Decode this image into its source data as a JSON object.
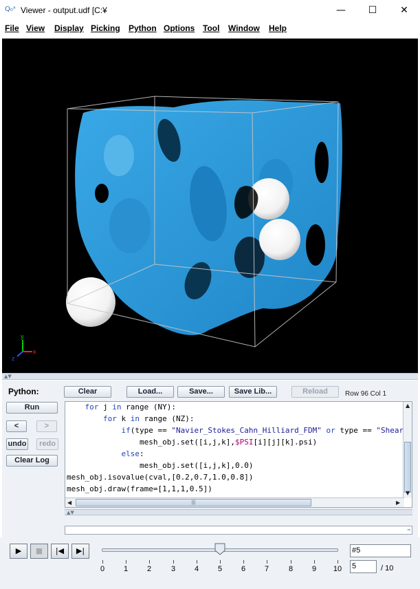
{
  "window": {
    "icon_text": "Q₀ᵃ",
    "title": "Viewer - output.udf [C:¥",
    "minimize_glyph": "—",
    "maximize_glyph": "☐",
    "close_glyph": "✕"
  },
  "menu": [
    "File",
    "Display",
    "Picking",
    "Python",
    "Options",
    "Tool",
    "Window",
    "Help"
  ],
  "menu_view": "View",
  "viewport": {
    "background": "#000000",
    "surface_color": "#2e9fdf",
    "particle_color": "#ffffff",
    "axis_labels": {
      "x": "x",
      "y": "y",
      "z": "z"
    }
  },
  "python_panel": {
    "label": "Python:",
    "run": "Run",
    "prev": "<",
    "next": ">",
    "undo": "undo",
    "redo": "redo",
    "clear_log": "Clear Log",
    "clear": "Clear",
    "load": "Load...",
    "save": "Save...",
    "save_lib": "Save Lib...",
    "reload": "Reload",
    "row_col": "Row 96 Col 1",
    "code_lines": [
      [
        "    ",
        [
          "kw",
          "for"
        ],
        " j ",
        [
          "kw",
          "in"
        ],
        " range (NY):"
      ],
      [
        "        ",
        [
          "kw",
          "for"
        ],
        " k ",
        [
          "kw",
          "in"
        ],
        " range (NZ):"
      ],
      [
        "            ",
        [
          "kw",
          "if"
        ],
        "(type == ",
        [
          "str",
          "\"Navier_Stokes_Cahn_Hilliard_FDM\""
        ],
        " ",
        [
          "kw",
          "or"
        ],
        " type == ",
        [
          "str",
          "\"Shear_NS_LE_"
        ]
      ],
      [
        "                mesh_obj.set([i,j,k],",
        [
          "var",
          "$PSI"
        ],
        "[i][j][k].psi)"
      ],
      [
        "            ",
        [
          "kw",
          "else"
        ],
        ":"
      ],
      [
        "                mesh_obj.set([i,j,k],0.0)"
      ],
      [
        "mesh_obj.isovalue(cval,[0.2,0.7,1.0,0.8])"
      ],
      [
        "mesh_obj.draw(frame=[1,1,1,0.5])"
      ]
    ]
  },
  "playback": {
    "play": "▶",
    "stop": "■",
    "first": "|◀",
    "last": "▶|",
    "slider_value": 5,
    "slider_max": 10,
    "ticks": [
      "0",
      "1",
      "2",
      "3",
      "4",
      "5",
      "6",
      "7",
      "8",
      "9",
      "10"
    ],
    "frame_label": "#5",
    "frame_input": "5",
    "total": "/ 10"
  }
}
